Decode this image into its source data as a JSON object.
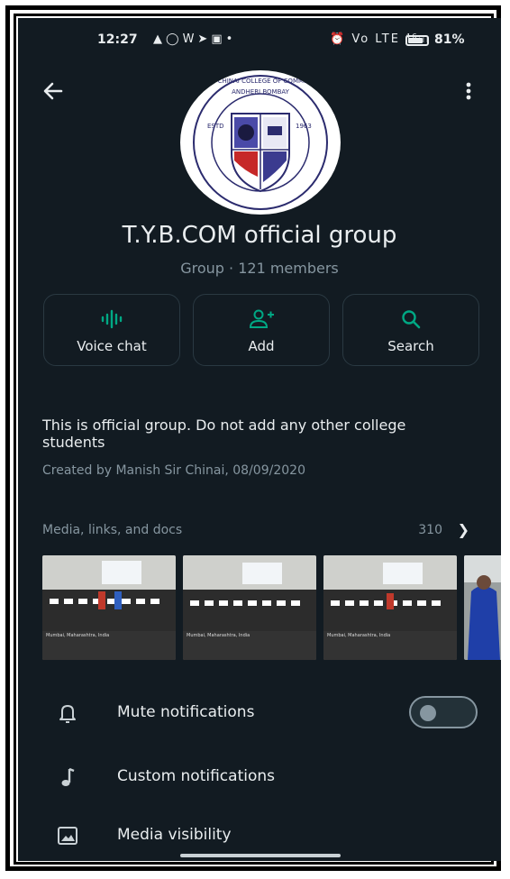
{
  "status_bar": {
    "time": "12:27",
    "left_icons": [
      "snapchat-icon",
      "whatsapp-icon",
      "wps-icon",
      "telegram-icon",
      "message-icon",
      "dot-icon"
    ],
    "signal_text": "Vo LTE ⁴⁶ᵢₗₗ",
    "battery_percent": "81%",
    "battery_level": 0.81
  },
  "header": {
    "back_icon": "arrow-back-icon",
    "menu_icon": "more-vert-icon",
    "logo": {
      "top_text": "SHRI CHINAI COLLEGE OF COMMERCE",
      "sub_text": "ANDHERI  BOMBAY",
      "estd_left": "ESTD",
      "estd_right": "1963"
    }
  },
  "group": {
    "name": "T.Y.B.COM official group",
    "meta": "Group · 121 members"
  },
  "actions": [
    {
      "label": "Voice chat",
      "icon": "voice-wave-icon"
    },
    {
      "label": "Add",
      "icon": "person-add-icon"
    },
    {
      "label": "Search",
      "icon": "search-icon"
    }
  ],
  "description": {
    "text": "This is official group. Do not add any other college students",
    "created": "Created by Manish Sir Chinai, 08/09/2020"
  },
  "media": {
    "header": "Media, links, and docs",
    "count": "310",
    "chevron": "chevron-right-icon",
    "thumbnails": [
      {
        "caption": "Mumbai, Maharashtra, India",
        "icon": "photo-thumbnail"
      },
      {
        "caption": "Mumbai, Maharashtra, India",
        "icon": "photo-thumbnail"
      },
      {
        "caption": "Mumbai, Maharashtra, India",
        "icon": "photo-thumbnail"
      },
      {
        "caption": "",
        "icon": "photo-thumbnail"
      }
    ]
  },
  "settings": [
    {
      "label": "Mute notifications",
      "icon": "bell-icon",
      "toggle": false
    },
    {
      "label": "Custom notifications",
      "icon": "music-note-icon"
    },
    {
      "label": "Media visibility",
      "icon": "image-icon"
    }
  ],
  "colors": {
    "background": "#121b22",
    "accent": "#00a884",
    "text_primary": "#e9edef",
    "text_secondary": "#8696a0",
    "divider": "#2a3942"
  }
}
